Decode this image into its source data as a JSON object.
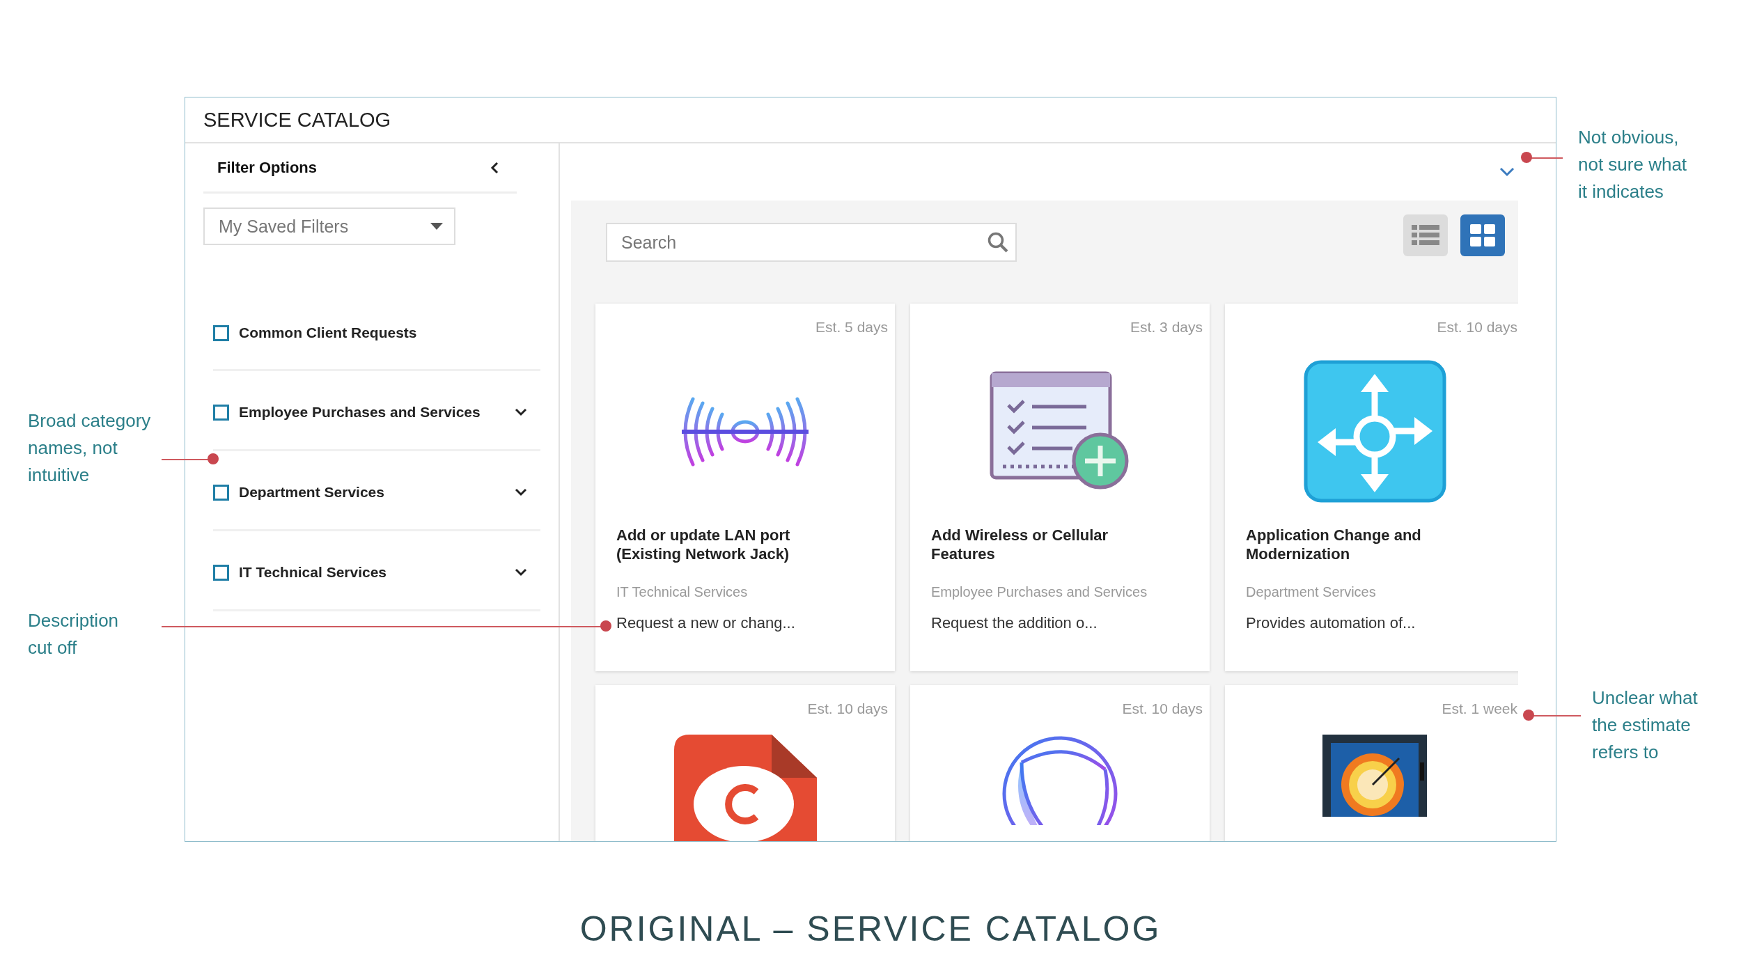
{
  "window": {
    "title": "SERVICE CATALOG"
  },
  "sidebar": {
    "title": "Filter Options",
    "saved_filters": {
      "value": "My Saved Filters"
    },
    "categories": [
      {
        "label": "Common Client Requests",
        "checked": false,
        "expandable": false
      },
      {
        "label": "Employee Purchases and Services",
        "checked": false,
        "expandable": true
      },
      {
        "label": "Department Services",
        "checked": false,
        "expandable": true
      },
      {
        "label": "IT Technical Services",
        "checked": false,
        "expandable": true
      }
    ]
  },
  "search": {
    "placeholder": "Search"
  },
  "view_toggles": [
    {
      "kind": "list",
      "selected": false
    },
    {
      "kind": "grid",
      "selected": true
    }
  ],
  "cards": [
    {
      "estimate": "Est. 5 days",
      "kind": "wave",
      "title": "Add or update LAN port (Existing Network Jack)",
      "category": "IT Technical Services",
      "description": "Request a new or chang..."
    },
    {
      "estimate": "Est. 3 days",
      "kind": "checklist",
      "title": "Add Wireless or Cellular Features",
      "category": "Employee Purchases and Services",
      "description": "Request the addition o..."
    },
    {
      "estimate": "Est. 10 days",
      "kind": "arrows",
      "title": "Application Change and Modernization",
      "category": "Department Services",
      "description": "Provides automation of..."
    },
    {
      "estimate": "Est. 10 days",
      "kind": "document"
    },
    {
      "estimate": "Est. 10 days",
      "kind": "sphere"
    },
    {
      "estimate": "Est. 1 week",
      "kind": "dial"
    }
  ],
  "annotations": [
    {
      "text": "Not obvious, not sure what it indicates"
    },
    {
      "text": "Broad category names, not intuitive"
    },
    {
      "text": "Description cut off"
    },
    {
      "text": "Unclear what the estimate refers to"
    }
  ],
  "caption": "ORIGINAL – SERVICE CATALOG"
}
